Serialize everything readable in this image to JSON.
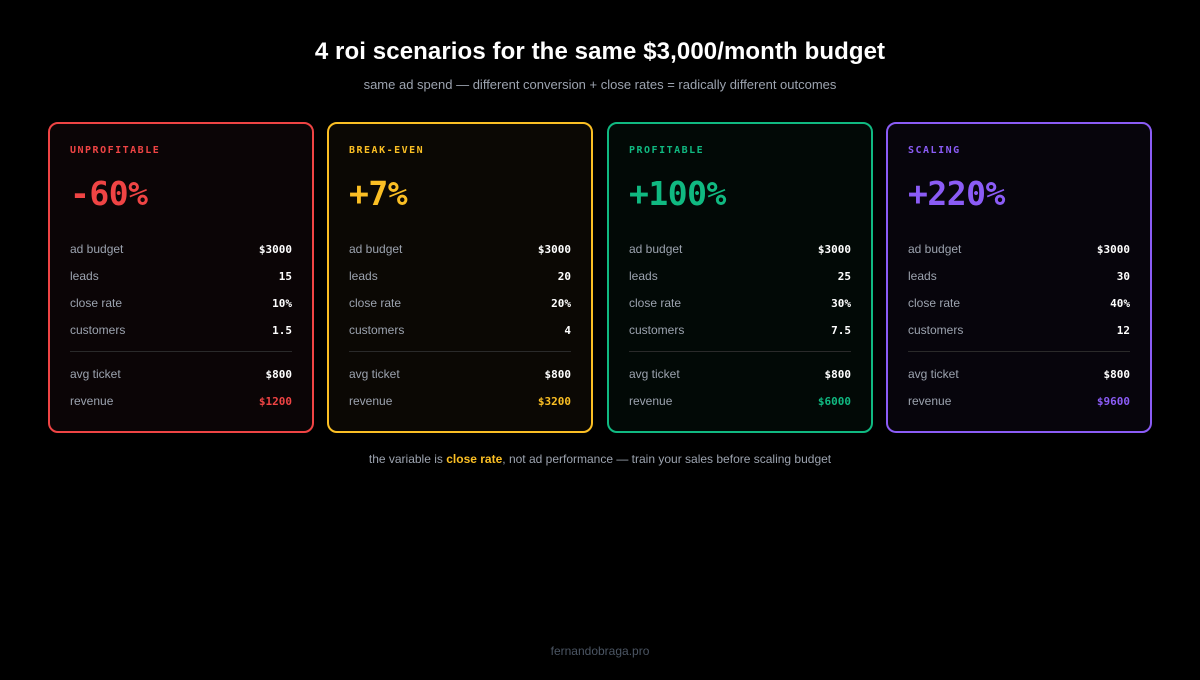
{
  "header": {
    "title": "4 roi scenarios for the same $3,000/month budget",
    "subtitle": "same ad spend — different conversion + close rates = radically different outcomes"
  },
  "colors": {
    "unprofitable": "#ef4444",
    "break_even": "#fbbf24",
    "profitable": "#10b981",
    "scaling": "#8b5cf6"
  },
  "cards": [
    {
      "label": "UNPROFITABLE",
      "roi": "-60%",
      "rows": [
        {
          "label": "ad budget",
          "value": "$3000"
        },
        {
          "label": "leads",
          "value": "15"
        },
        {
          "label": "close rate",
          "value": "10%"
        },
        {
          "label": "customers",
          "value": "1.5"
        },
        {
          "label": "avg ticket",
          "value": "$800"
        },
        {
          "label": "revenue",
          "value": "$1200"
        }
      ]
    },
    {
      "label": "BREAK-EVEN",
      "roi": "+7%",
      "rows": [
        {
          "label": "ad budget",
          "value": "$3000"
        },
        {
          "label": "leads",
          "value": "20"
        },
        {
          "label": "close rate",
          "value": "20%"
        },
        {
          "label": "customers",
          "value": "4"
        },
        {
          "label": "avg ticket",
          "value": "$800"
        },
        {
          "label": "revenue",
          "value": "$3200"
        }
      ]
    },
    {
      "label": "PROFITABLE",
      "roi": "+100%",
      "rows": [
        {
          "label": "ad budget",
          "value": "$3000"
        },
        {
          "label": "leads",
          "value": "25"
        },
        {
          "label": "close rate",
          "value": "30%"
        },
        {
          "label": "customers",
          "value": "7.5"
        },
        {
          "label": "avg ticket",
          "value": "$800"
        },
        {
          "label": "revenue",
          "value": "$6000"
        }
      ]
    },
    {
      "label": "SCALING",
      "roi": "+220%",
      "rows": [
        {
          "label": "ad budget",
          "value": "$3000"
        },
        {
          "label": "leads",
          "value": "30"
        },
        {
          "label": "close rate",
          "value": "40%"
        },
        {
          "label": "customers",
          "value": "12"
        },
        {
          "label": "avg ticket",
          "value": "$800"
        },
        {
          "label": "revenue",
          "value": "$9600"
        }
      ]
    }
  ],
  "footnote": {
    "prefix": "the variable is ",
    "highlight": "close rate",
    "suffix": ", not ad performance — train your sales before scaling budget"
  },
  "signature": "fernandobraga.pro"
}
